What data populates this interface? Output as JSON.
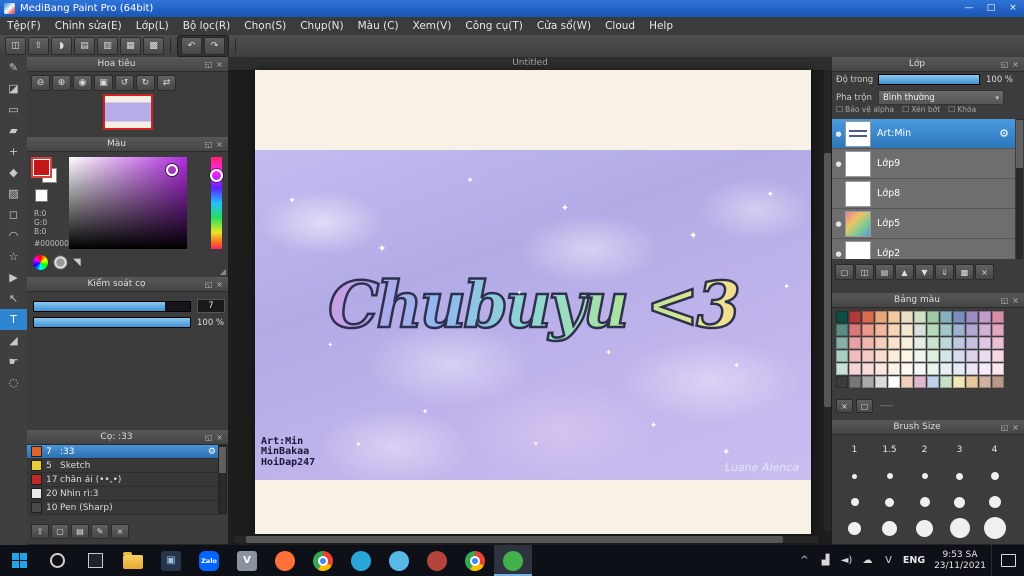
{
  "window": {
    "title": "MediBang Paint Pro (64bit)",
    "controls": {
      "minimize": "—",
      "maximize": "□",
      "close": "×"
    }
  },
  "ui": {
    "popout": "◱",
    "close": "×",
    "caret": "▾",
    "grip": "◢",
    "checkbox": "☐",
    "eye": "●",
    "gear": "⚙"
  },
  "menubar": {
    "items": [
      {
        "id": "tep",
        "label": "Tệp(F)"
      },
      {
        "id": "chinh-sua",
        "label": "Chỉnh sửa(E)"
      },
      {
        "id": "lop",
        "label": "Lớp(L)"
      },
      {
        "id": "bo-loc",
        "label": "Bộ lọc(R)"
      },
      {
        "id": "chon",
        "label": "Chọn(S)"
      },
      {
        "id": "chup",
        "label": "Chụp(N)"
      },
      {
        "id": "mau",
        "label": "Màu (C)"
      },
      {
        "id": "xem",
        "label": "Xem(V)"
      },
      {
        "id": "cong-cu",
        "label": "Công cụ(T)"
      },
      {
        "id": "cua-so",
        "label": "Cửa sổ(W)"
      },
      {
        "id": "cloud",
        "label": "Cloud"
      },
      {
        "id": "help",
        "label": "Help"
      }
    ]
  },
  "toolbar": {
    "icons": [
      {
        "name": "save-icon",
        "glyph": "◫"
      },
      {
        "name": "publish-icon",
        "glyph": "⇧"
      },
      {
        "name": "comment-icon",
        "glyph": "◗"
      },
      {
        "name": "new-page-icon",
        "glyph": "▤"
      },
      {
        "name": "page-list-icon",
        "glyph": "▥"
      },
      {
        "name": "grid-icon",
        "glyph": "▦"
      },
      {
        "name": "workspace-icon",
        "glyph": "▩"
      }
    ],
    "undo_glyph": "↶",
    "redo_glyph": "↷"
  },
  "tools": {
    "items": [
      {
        "name": "pen-tool",
        "glyph": "✎"
      },
      {
        "name": "eraser-tool",
        "glyph": "◪"
      },
      {
        "name": "shape-tool",
        "glyph": "▭"
      },
      {
        "name": "airbrush-tool",
        "glyph": "▰"
      },
      {
        "name": "move-tool",
        "glyph": "+"
      },
      {
        "name": "fill-tool",
        "glyph": "◆"
      },
      {
        "name": "gradient-tool",
        "glyph": "▨"
      },
      {
        "name": "select-tool",
        "glyph": "◻"
      },
      {
        "name": "lasso-tool",
        "glyph": "◠"
      },
      {
        "name": "magic-wand-tool",
        "glyph": "☆"
      },
      {
        "name": "operation-tool",
        "glyph": "▶"
      },
      {
        "name": "pointer-tool",
        "glyph": "↖"
      },
      {
        "name": "text-tool",
        "glyph": "T",
        "active": true
      },
      {
        "name": "eyedropper-tool",
        "glyph": "◢"
      },
      {
        "name": "hand-tool",
        "glyph": "☛"
      },
      {
        "name": "zoom-tool",
        "glyph": "◌"
      }
    ]
  },
  "panels": {
    "navigator": {
      "title": "Hoa tiêu",
      "buttons": [
        {
          "name": "zoom-out-button",
          "glyph": "⊖"
        },
        {
          "name": "zoom-in-button",
          "glyph": "⊕"
        },
        {
          "name": "zoom-100-button",
          "glyph": "◉"
        },
        {
          "name": "fit-screen-button",
          "glyph": "▣"
        },
        {
          "name": "rotate-left-button",
          "glyph": "↺"
        },
        {
          "name": "rotate-right-button",
          "glyph": "↻"
        },
        {
          "name": "flip-button",
          "glyph": "⇄"
        }
      ]
    },
    "color": {
      "title": "Màu",
      "r": "R:0",
      "g": "G:0",
      "b": "B:0",
      "hex": "#000000",
      "footer": [
        {
          "name": "color-wheel-icon",
          "kind": "wheel"
        },
        {
          "name": "grayscale-wheel-icon",
          "kind": "wheel-gray"
        },
        {
          "name": "eyedropper-icon",
          "kind": "glyph",
          "glyph": "◥"
        }
      ]
    },
    "brush_control": {
      "title": "Kiểm soát cọ",
      "size_value": "7",
      "opacity_value": "100 %"
    },
    "brushes": {
      "title": "Cọ: :33",
      "items": [
        {
          "num": "7",
          "label": ":33",
          "chip": "#e06428",
          "selected": true
        },
        {
          "num": "5",
          "label": "Sketch",
          "chip": "#e6cc38"
        },
        {
          "num": "17",
          "label": "chân ái (••,•)",
          "chip": "#c22828"
        },
        {
          "num": "20",
          "label": "Nhìn rì:3",
          "chip": "#e8e8e8"
        },
        {
          "num": "10",
          "label": "Pen (Sharp)",
          "chip": "#484848"
        }
      ],
      "footer": [
        {
          "name": "scroll-up-icon",
          "glyph": "⇧"
        },
        {
          "name": "add-brush-icon",
          "glyph": "▢"
        },
        {
          "name": "brush-folder-icon",
          "glyph": "▤"
        },
        {
          "name": "edit-brush-icon",
          "glyph": "✎"
        },
        {
          "name": "delete-brush-icon",
          "glyph": "×"
        }
      ]
    },
    "layers": {
      "title": "Lớp",
      "opacity_label": "Độ trong",
      "opacity_value": "100 %",
      "blend_label": "Pha trộn",
      "blend_value": "Bình thường",
      "checkboxes": [
        {
          "id": "bao-ve-alpha",
          "label": "Bảo vệ alpha"
        },
        {
          "id": "xen-bot",
          "label": "Xén bớt"
        },
        {
          "id": "khoa",
          "label": "Khóa"
        }
      ],
      "items": [
        {
          "name": "Art:Min",
          "selected": true,
          "eye": true,
          "thumb": "text"
        },
        {
          "name": "Lớp9",
          "eye": true,
          "thumb": "white"
        },
        {
          "name": "Lớp8",
          "eye": false,
          "thumb": "white"
        },
        {
          "name": "Lớp5",
          "eye": true,
          "thumb": "art"
        },
        {
          "name": "Lớp2",
          "eye": true,
          "thumb": "white"
        }
      ],
      "actions": [
        {
          "name": "new-layer-icon",
          "glyph": "▢"
        },
        {
          "name": "duplicate-layer-icon",
          "glyph": "◫"
        },
        {
          "name": "new-folder-icon",
          "glyph": "▤"
        },
        {
          "name": "move-layer-up-icon",
          "glyph": "▲"
        },
        {
          "name": "move-layer-down-icon",
          "glyph": "▼"
        },
        {
          "name": "merge-layer-icon",
          "glyph": "⇓"
        },
        {
          "name": "layer-settings-icon",
          "glyph": "▩"
        },
        {
          "name": "delete-layer-icon",
          "glyph": "×"
        }
      ]
    },
    "palette": {
      "title": "Bảng màu",
      "footer_label": "----",
      "footer_icons": [
        {
          "name": "add-color-icon",
          "glyph": "▢"
        },
        {
          "name": "delete-color-icon",
          "glyph": "×"
        }
      ],
      "colors": [
        "#0f4c43",
        "#b23a3a",
        "#d96b4f",
        "#e8a87c",
        "#f2c9a1",
        "#e8e0c9",
        "#cfe0c3",
        "#a3c9a8",
        "#84b1be",
        "#7a8fc0",
        "#9b8cc4",
        "#c49bc9",
        "#d98ca6",
        "#5b8c85",
        "#d9777c",
        "#e89a8d",
        "#f2b8a0",
        "#f7d6b8",
        "#f2e8cf",
        "#d8e2dc",
        "#b8d8be",
        "#a2c7c9",
        "#9fb3d1",
        "#b3a6d1",
        "#d1b3d8",
        "#e0a8c0",
        "#88b0a8",
        "#e8a0a4",
        "#f0b8b0",
        "#f7cdbd",
        "#fae3cd",
        "#f7f0dd",
        "#e6ede8",
        "#cde3d2",
        "#bcd8da",
        "#bcc9e0",
        "#c9bfe0",
        "#dfc9e6",
        "#ecc0d4",
        "#a8cfc2",
        "#f0bcc0",
        "#f5cdc6",
        "#fadcd0",
        "#fcecda",
        "#fbf6e8",
        "#f0f5f1",
        "#ddeee2",
        "#d4e6e8",
        "#d4dced",
        "#dcd4ed",
        "#ecdcf0",
        "#f4d8e4",
        "#c8e2d8",
        "#f7d4d8",
        "#f9dcd8",
        "#fce8e0",
        "#fdf2e8",
        "#fdfaf0",
        "#f7faf7",
        "#eaf5ee",
        "#e6f0f2",
        "#e6ebf5",
        "#ebe6f5",
        "#f5eaf7",
        "#f9e8f0",
        "#3b3b3b",
        "#777777",
        "#aaaaaa",
        "#dddddd",
        "#ffffff",
        "#f2d0c0",
        "#e0b8d0",
        "#c0d0e8",
        "#c8e0c8",
        "#f0e8b8",
        "#e8c8a0",
        "#d0b0a0",
        "#b89888"
      ]
    },
    "brush_size": {
      "title": "Brush Size",
      "text_row": [
        "1",
        "1.5",
        "2",
        "3",
        "4"
      ],
      "preset_rows": [
        [
          5,
          6,
          8,
          10,
          15
        ],
        [
          20,
          25,
          30,
          40,
          50
        ],
        [
          60,
          80,
          100,
          150,
          200
        ]
      ]
    }
  },
  "canvas": {
    "tab": "Untitled",
    "artwork": {
      "title_text": "Chubuyu <3",
      "credits": [
        "Art:Min",
        "MinBakaa",
        "HoiDap247"
      ],
      "watermark": "Luane Alenca",
      "rainbow": [
        "#f0a8c8",
        "#c0a0e8",
        "#90b8f0",
        "#8fd8d0",
        "#aee49a",
        "#f0e48e",
        "#f4b48c"
      ],
      "sparkle": "✦"
    }
  },
  "taskbar": {
    "lang": "ENG",
    "clock": {
      "time": "9:53 SA",
      "date": "23/11/2021"
    },
    "apps": [
      {
        "name": "file-explorer-app",
        "kind": "folder"
      },
      {
        "name": "photos-app",
        "kind": "square",
        "bg": "#26354a",
        "glyph": "▣",
        "fg": "#9fc3e8"
      },
      {
        "name": "zalo-app",
        "kind": "rsquare",
        "bg": "#0166ff",
        "label": "Zalo"
      },
      {
        "name": "unikey-app",
        "kind": "square",
        "bg": "#8a93a0",
        "glyph": "V",
        "fg": "#ffffff"
      },
      {
        "name": "firefox-app",
        "kind": "circle",
        "bg": "#ff7139"
      },
      {
        "name": "chrome-app",
        "kind": "chrome"
      },
      {
        "name": "edge-app",
        "kind": "circle",
        "bg": "#2aa7d8"
      },
      {
        "name": "coccoc-app",
        "kind": "circle",
        "bg": "#58b8e8"
      },
      {
        "name": "brave-app",
        "kind": "circle",
        "bg": "#b5453a"
      },
      {
        "name": "chrome-profile-app",
        "kind": "chrome"
      },
      {
        "name": "medibang-app",
        "kind": "circle",
        "bg": "#43b14b",
        "active": true
      }
    ],
    "tray": [
      {
        "name": "hidden-icons-chevron",
        "glyph": "^"
      },
      {
        "name": "network-icon",
        "glyph": "▟"
      },
      {
        "name": "volume-icon",
        "glyph": "◄)"
      },
      {
        "name": "onedrive-icon",
        "glyph": "☁"
      },
      {
        "name": "unikey-tray-icon",
        "glyph": "V"
      }
    ]
  }
}
